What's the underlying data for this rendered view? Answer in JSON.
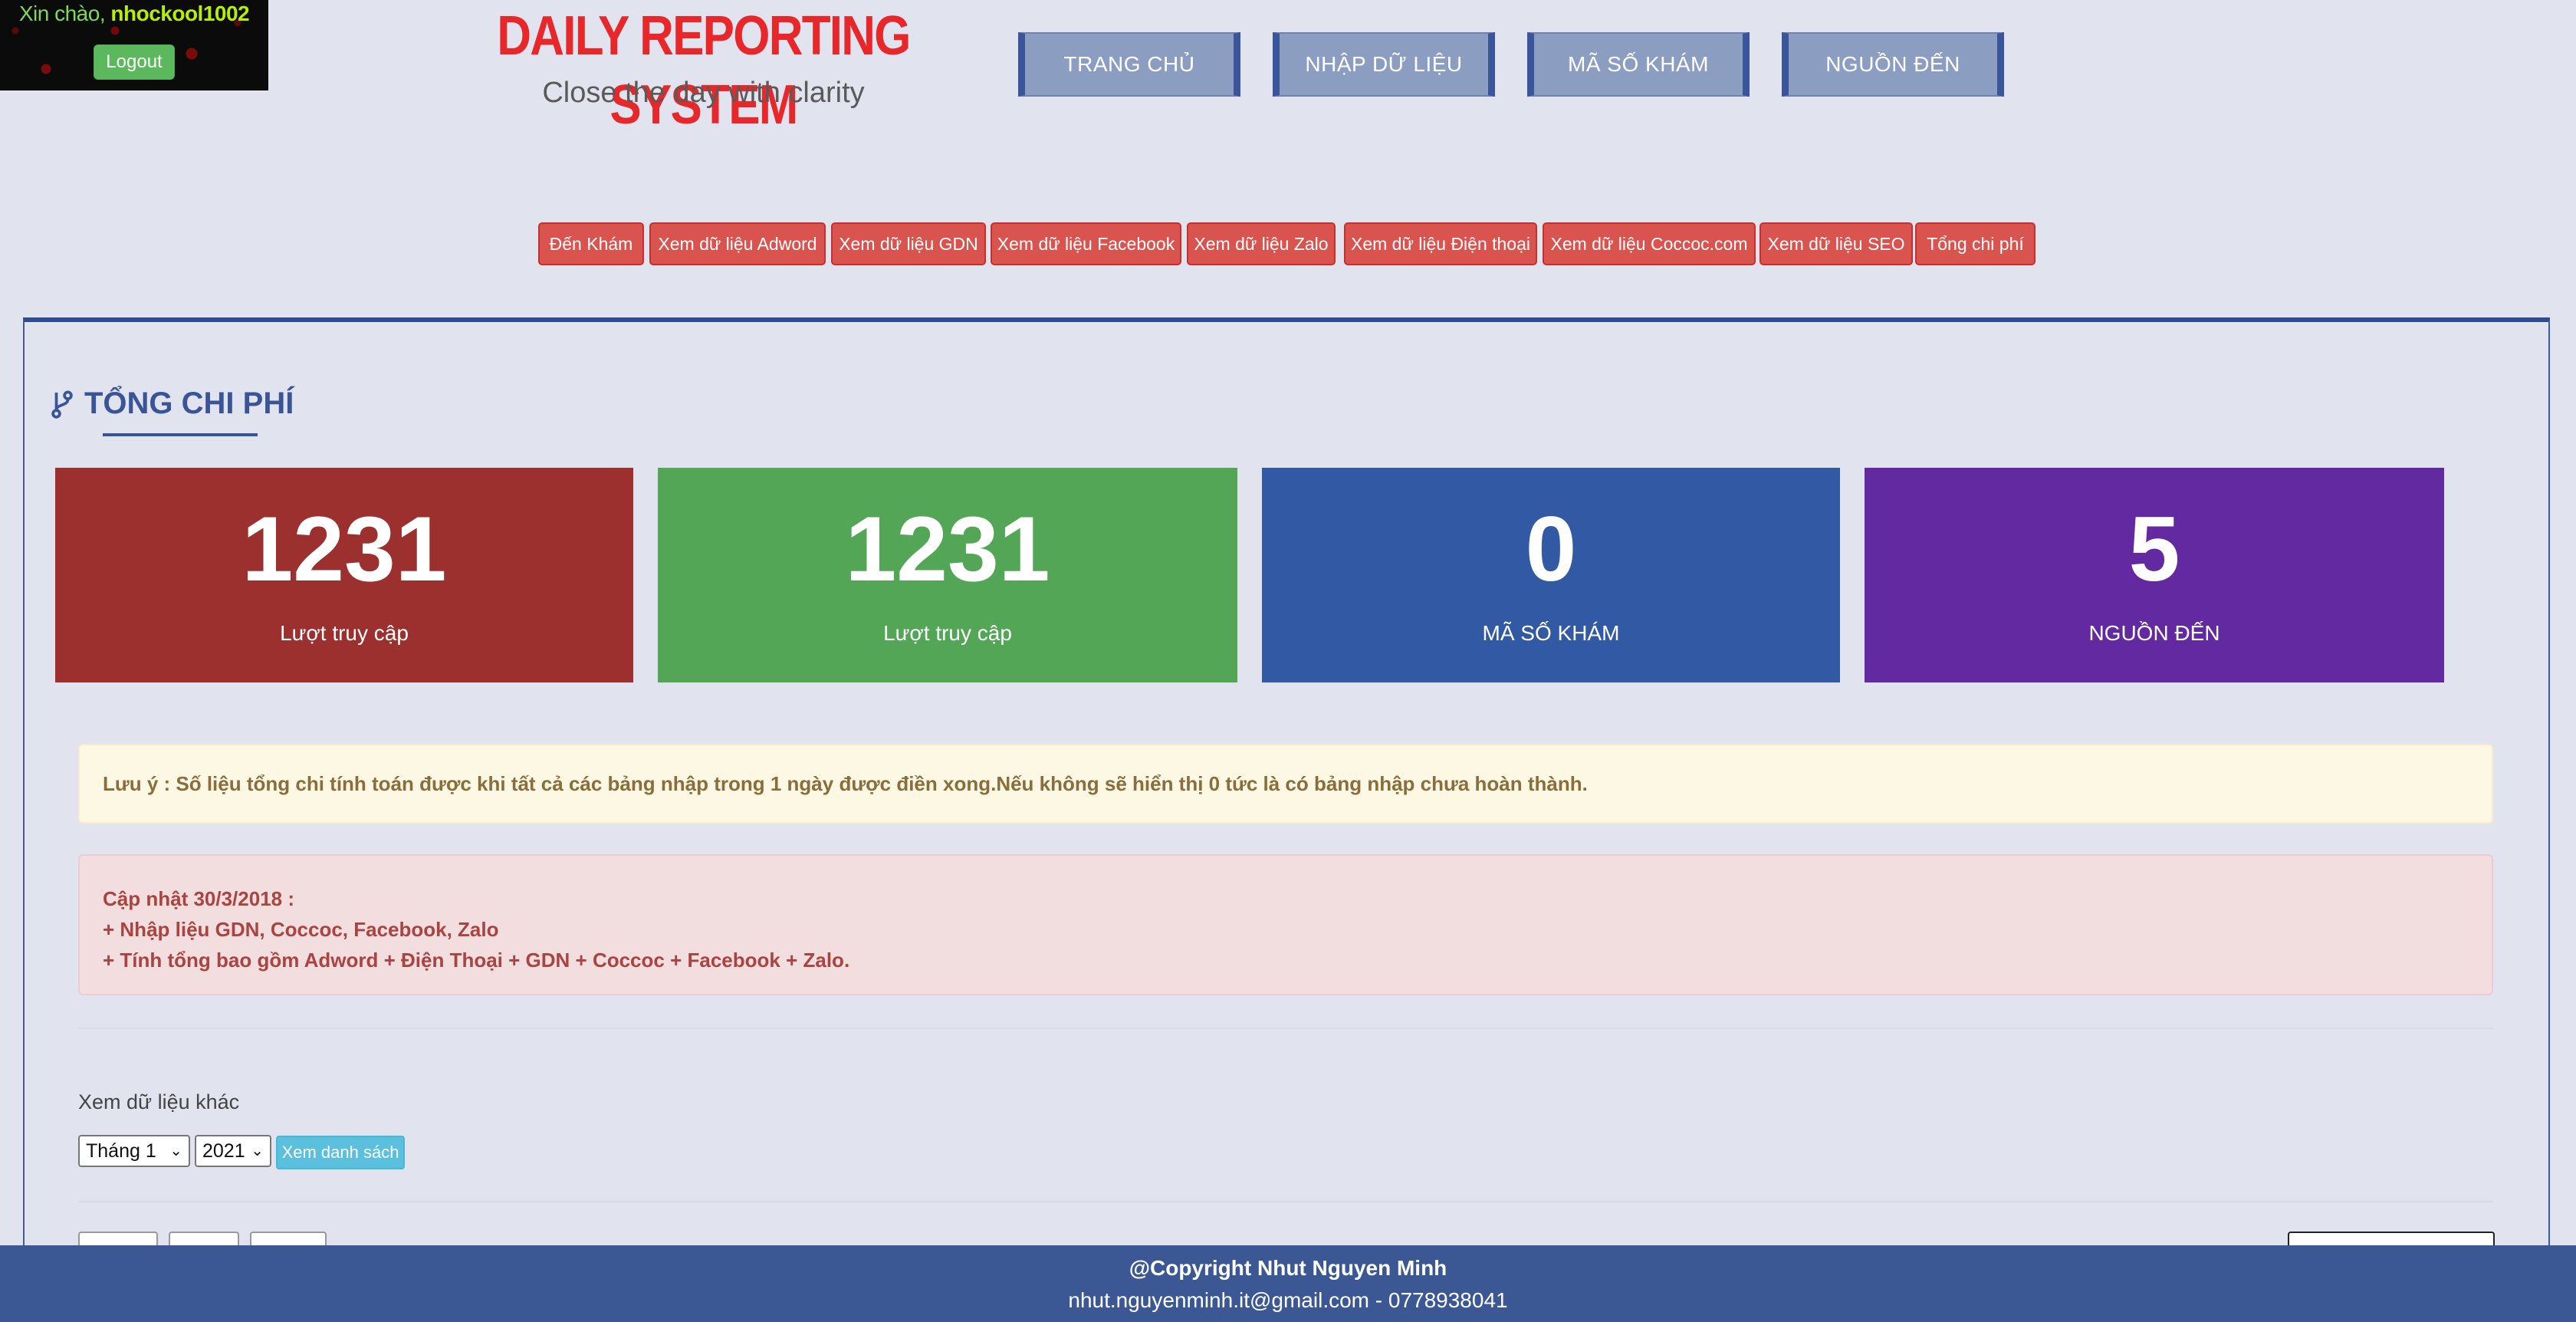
{
  "user": {
    "greeting": "Xin chào,",
    "username": "nhockool1002",
    "logout_label": "Logout"
  },
  "brand": {
    "title": "DAILY REPORTING SYSTEM",
    "subtitle": "Close the day with clarity"
  },
  "top_nav": [
    "TRANG CHỦ",
    "NHẬP DỮ LIỆU",
    "MÃ SỐ KHÁM",
    "NGUỒN ĐẾN"
  ],
  "sub_nav": [
    "Đến Khám",
    "Xem dữ liệu Adword",
    "Xem dữ liệu GDN",
    "Xem dữ liệu Facebook",
    "Xem dữ liệu Zalo",
    "Xem dữ liệu Điện thoại",
    "Xem dữ liệu Coccoc.com",
    "Xem dữ liệu SEO",
    "Tổng chi phí"
  ],
  "section": {
    "title": "TỔNG CHI PHÍ",
    "icon": "branch-icon"
  },
  "stats": [
    {
      "value": "1231",
      "label": "Lượt truy cập",
      "color": "#9b302e"
    },
    {
      "value": "1231",
      "label": "Lượt truy cập",
      "color": "#53a656"
    },
    {
      "value": "0",
      "label": "MÃ SỐ KHÁM",
      "color": "#3259a3"
    },
    {
      "value": "5",
      "label": "NGUỒN ĐẾN",
      "color": "#6229a0"
    }
  ],
  "notice": {
    "text": "Lưu ý : Số liệu tổng chi tính toán được khi tất cả các bảng nhập trong 1 ngày được điền xong.Nếu không sẽ hiển thị 0 tức là có bảng nhập chưa hoàn thành."
  },
  "update": {
    "heading": "Cập nhật 30/3/2018 :",
    "line1": "+ Nhập liệu GDN, Coccoc, Facebook, Zalo",
    "line2": "+ Tính tổng bao gồm Adword + Điện Thoại + GDN + Coccoc + Facebook + Zalo."
  },
  "filter": {
    "label": "Xem dữ liệu khác",
    "month": "Tháng 1",
    "year": "2021",
    "button": "Xem danh sách"
  },
  "footer": {
    "copyright": "@Copyright Nhut Nguyen Minh",
    "contact": "nhut.nguyenminh.it@gmail.com - 0778938041"
  }
}
